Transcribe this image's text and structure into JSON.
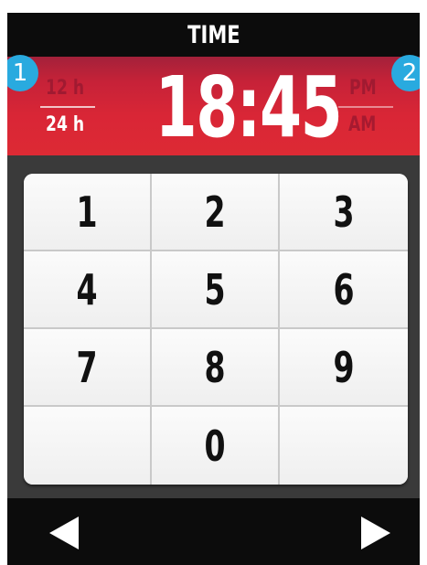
{
  "header": {
    "title": "TIME"
  },
  "time_display": {
    "value": "18:45",
    "format_options": {
      "option_12h": "12 h",
      "option_24h": "24 h",
      "selected": "24 h"
    },
    "period_options": {
      "pm": "PM",
      "am": "AM"
    }
  },
  "callouts": {
    "marker_1": "1",
    "marker_2": "2"
  },
  "keypad": {
    "keys": [
      "1",
      "2",
      "3",
      "4",
      "5",
      "6",
      "7",
      "8",
      "9",
      "",
      "0",
      ""
    ]
  },
  "navigation": {
    "prev_icon": "left-triangle-icon",
    "next_icon": "right-triangle-icon"
  },
  "colors": {
    "accent_red": "#d92636",
    "callout_blue": "#29aadf",
    "bar_black": "#0c0c0c"
  }
}
